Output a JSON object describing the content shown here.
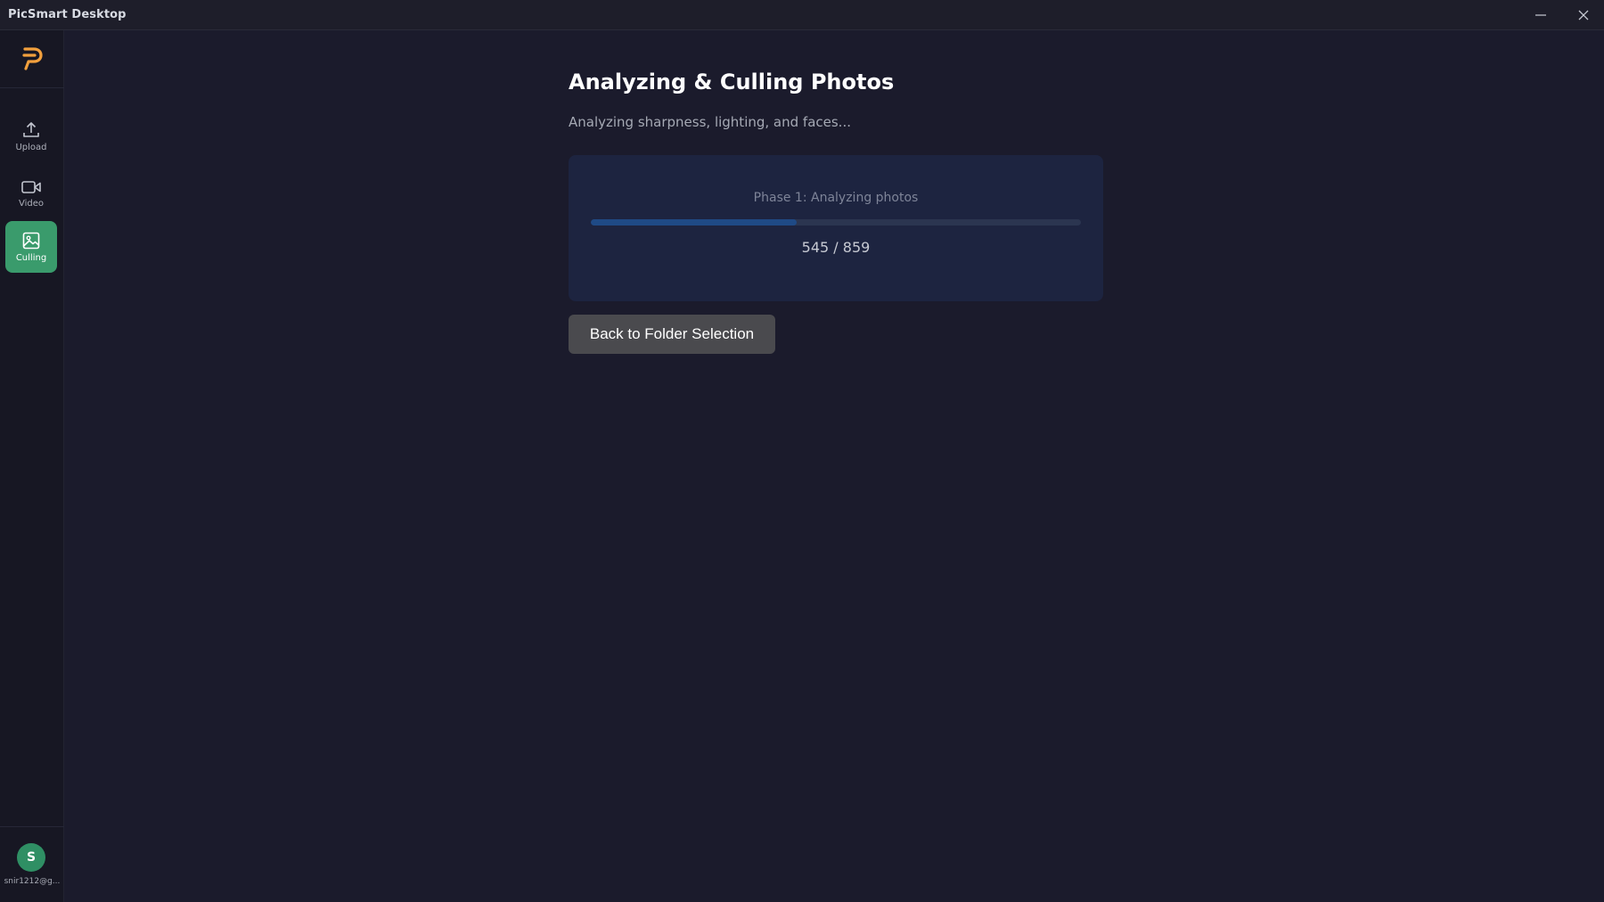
{
  "window": {
    "title": "PicSmart Desktop",
    "minimize_icon": "minimize-icon",
    "close_icon": "close-icon"
  },
  "sidebar": {
    "logo_icon": "picsmart-logo",
    "items": [
      {
        "label": "Upload",
        "icon": "upload-icon",
        "active": false
      },
      {
        "label": "Video",
        "icon": "video-icon",
        "active": false
      },
      {
        "label": "Culling",
        "icon": "image-icon",
        "active": true
      }
    ],
    "user": {
      "initial": "S",
      "email": "snir1212@g..."
    }
  },
  "main": {
    "title": "Analyzing & Culling Photos",
    "subtitle": "Analyzing sharpness, lighting, and faces...",
    "progress": {
      "phase": "Phase 1: Analyzing photos",
      "current": 545,
      "total": 859,
      "count_text": "545 / 859",
      "fraction": 0.42
    },
    "back_button": "Back to Folder Selection"
  },
  "colors": {
    "background": "#1b1b2c",
    "sidebar": "#171723",
    "accent_active": "#3a9b6c",
    "progress_fill": "#1f4a86",
    "card": "#1d2440",
    "logo": "#f2a03d"
  }
}
